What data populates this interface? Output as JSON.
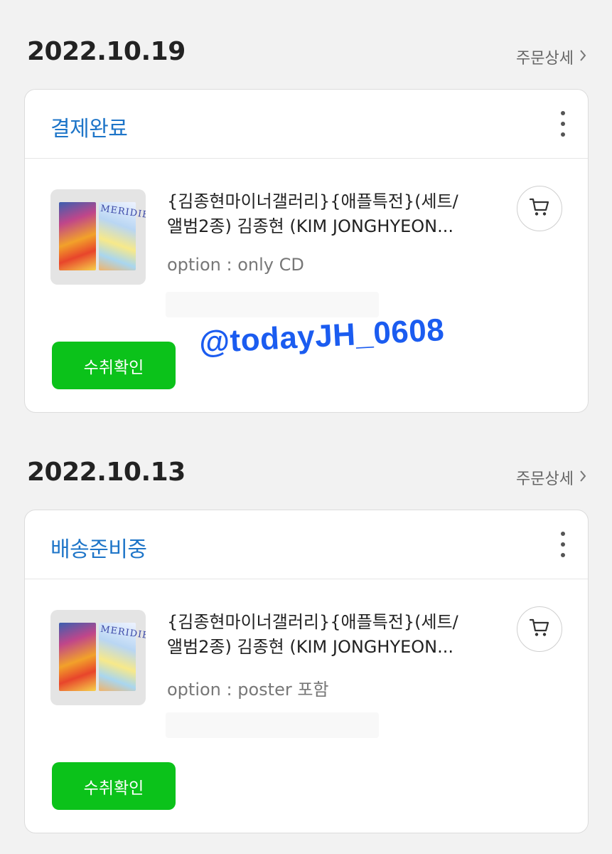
{
  "orders": [
    {
      "date": "2022.10.19",
      "detail_label": "주문상세",
      "status": "결제완료",
      "product_title_line1": "{김종현마이너갤러리}{애플특전}(세트/",
      "product_title_line2": "앨범2종) 김종현 (KIM JONGHYEON...",
      "option": "option : only CD",
      "album_art_text": "MERIDIEM",
      "confirm_label": "수취확인"
    },
    {
      "date": "2022.10.13",
      "detail_label": "주문상세",
      "status": "배송준비중",
      "product_title_line1": "{김종현마이너갤러리}{애플특전}(세트/",
      "product_title_line2": "앨범2종) 김종현 (KIM JONGHYEON...",
      "option": "option : poster 포함",
      "album_art_text": "MERIDIEM",
      "confirm_label": "수취확인"
    }
  ],
  "watermark": "@todayJH_0608",
  "colors": {
    "status_blue": "#1e75c8",
    "confirm_green": "#0bc21a",
    "watermark_blue": "#1b5cf0"
  },
  "icons": [
    "chevron-right-icon",
    "kebab-menu-icon",
    "cart-icon"
  ]
}
